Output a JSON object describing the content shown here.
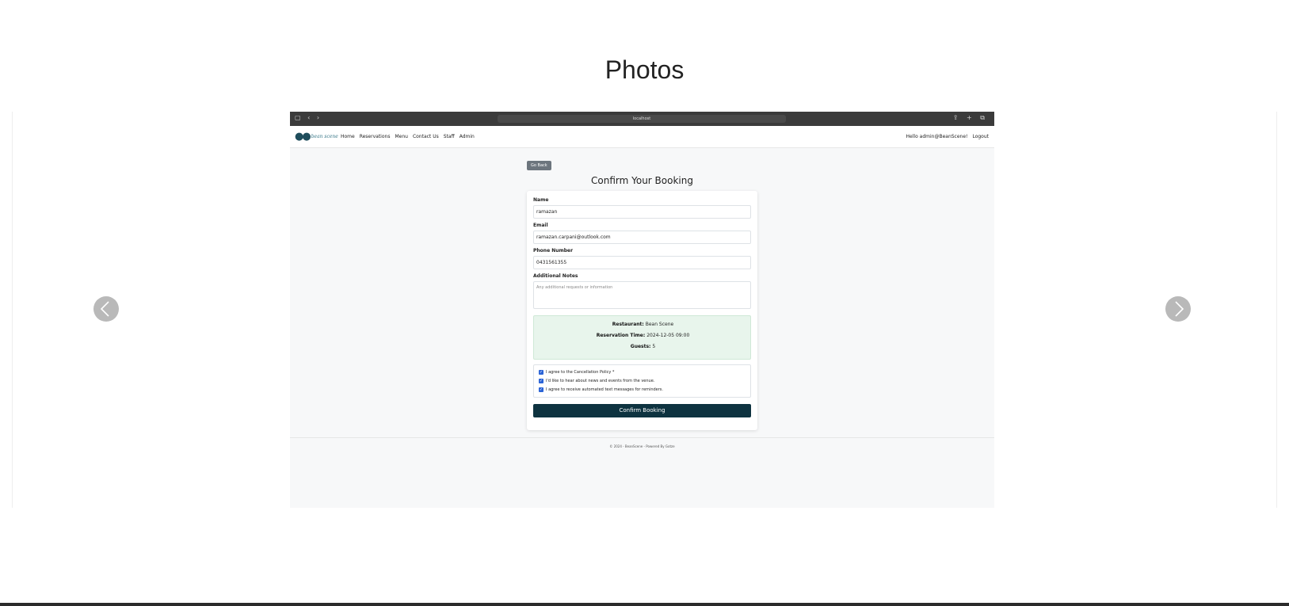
{
  "page": {
    "title": "Photos"
  },
  "carousel": {
    "prev_label": "Previous",
    "next_label": "Next"
  },
  "screenshot": {
    "browser": {
      "url": "localhost"
    },
    "nav": {
      "logo_text": "bean scene",
      "links": [
        "Home",
        "Reservations",
        "Menu",
        "Contact Us",
        "Staff",
        "Admin"
      ],
      "greeting": "Hello admin@BeanScene!",
      "logout": "Logout"
    },
    "go_back": "Go Back",
    "form_title": "Confirm Your Booking",
    "fields": {
      "name_label": "Name",
      "name_value": "ramazan",
      "email_label": "Email",
      "email_value": "ramazan.carpani@outlook.com",
      "phone_label": "Phone Number",
      "phone_value": "0431561355",
      "notes_label": "Additional Notes",
      "notes_placeholder": "Any additional requests or information"
    },
    "summary": {
      "restaurant_label": "Restaurant:",
      "restaurant_value": "Bean Scene",
      "time_label": "Reservation Time:",
      "time_value": "2024-12-05 09:00",
      "guests_label": "Guests:",
      "guests_value": "5"
    },
    "agreements": [
      {
        "label": "I agree to the Cancellation Policy *",
        "checked": true
      },
      {
        "label": "I'd like to hear about news and events from the venue.",
        "checked": true
      },
      {
        "label": "I agree to receive automated text messages for reminders.",
        "checked": true
      }
    ],
    "confirm_button": "Confirm Booking",
    "footer": "© 2024 - BeanScene - Powered By Gotze"
  }
}
